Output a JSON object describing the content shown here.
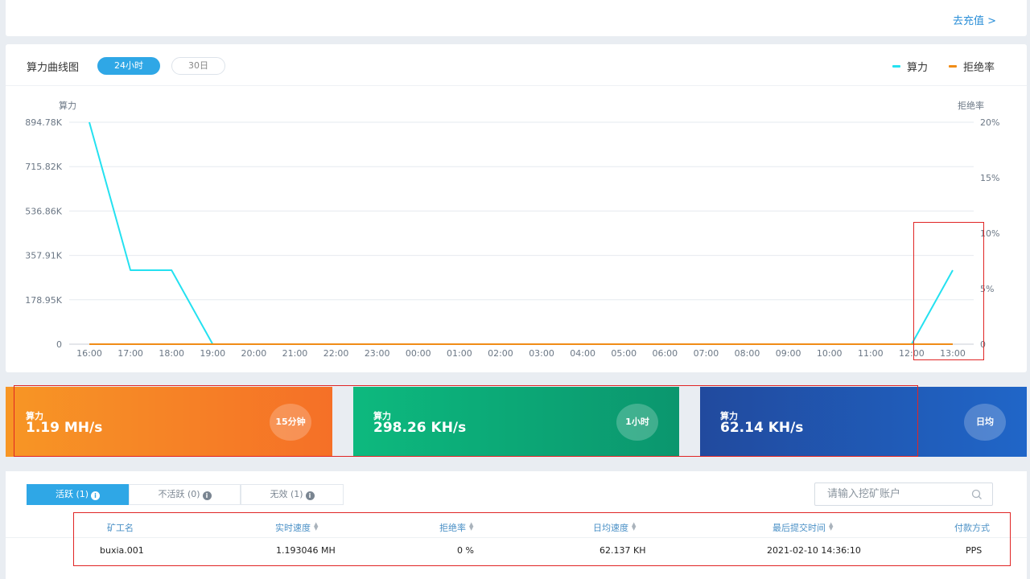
{
  "top": {
    "recharge_link": "去充值 >"
  },
  "chart_header": {
    "title": "算力曲线图",
    "tab_24h": "24小时",
    "tab_30d": "30日",
    "legend": [
      {
        "label": "算力",
        "color": "#24e1f0"
      },
      {
        "label": "拒绝率",
        "color": "#f08c17"
      }
    ]
  },
  "chart_data": {
    "type": "line",
    "ylabel_left": "算力",
    "ylabel_right": "拒绝率",
    "y_ticks_left": [
      "894.78K",
      "715.82K",
      "536.86K",
      "357.91K",
      "178.95K",
      "0"
    ],
    "y_ticks_right": [
      "20%",
      "15%",
      "10%",
      "5%",
      "0"
    ],
    "ylim_left": [
      0,
      894.78
    ],
    "ylim_right": [
      0,
      20
    ],
    "x": [
      "16:00",
      "17:00",
      "18:00",
      "19:00",
      "20:00",
      "21:00",
      "22:00",
      "23:00",
      "00:00",
      "01:00",
      "02:00",
      "03:00",
      "04:00",
      "05:00",
      "06:00",
      "07:00",
      "08:00",
      "09:00",
      "10:00",
      "11:00",
      "12:00",
      "13:00"
    ],
    "grid": true,
    "legend_position": "top-right",
    "series": [
      {
        "name": "算力",
        "axis": "left",
        "unit": "K",
        "color": "#24e1f0",
        "values": [
          894.78,
          298.26,
          298.26,
          0,
          0,
          0,
          0,
          0,
          0,
          0,
          0,
          0,
          0,
          0,
          0,
          0,
          0,
          0,
          0,
          0,
          0,
          298.26
        ]
      },
      {
        "name": "拒绝率",
        "axis": "right",
        "unit": "%",
        "color": "#f08c17",
        "values": [
          0,
          0,
          0,
          0,
          0,
          0,
          0,
          0,
          0,
          0,
          0,
          0,
          0,
          0,
          0,
          0,
          0,
          0,
          0,
          0,
          0,
          0
        ]
      }
    ]
  },
  "stats": [
    {
      "label": "算力",
      "value": "1.19 MH/s",
      "period": "15分钟"
    },
    {
      "label": "算力",
      "value": "298.26 KH/s",
      "period": "1小时"
    },
    {
      "label": "算力",
      "value": "62.14 KH/s",
      "period": "日均"
    }
  ],
  "workers": {
    "tabs": [
      {
        "label": "活跃 (1)"
      },
      {
        "label": "不活跃 (0)"
      },
      {
        "label": "无效 (1)"
      }
    ],
    "info_glyph": "i",
    "search_placeholder": "请输入挖矿账户",
    "columns": [
      "矿工名",
      "实时速度",
      "拒绝率",
      "日均速度",
      "最后提交时间",
      "付款方式"
    ],
    "rows": [
      {
        "name": "buxia.001",
        "speed": "1.193046 MH",
        "reject": "0 %",
        "avg": "62.137 KH",
        "last_submit": "2021-02-10 14:36:10",
        "payment": "PPS"
      }
    ]
  }
}
